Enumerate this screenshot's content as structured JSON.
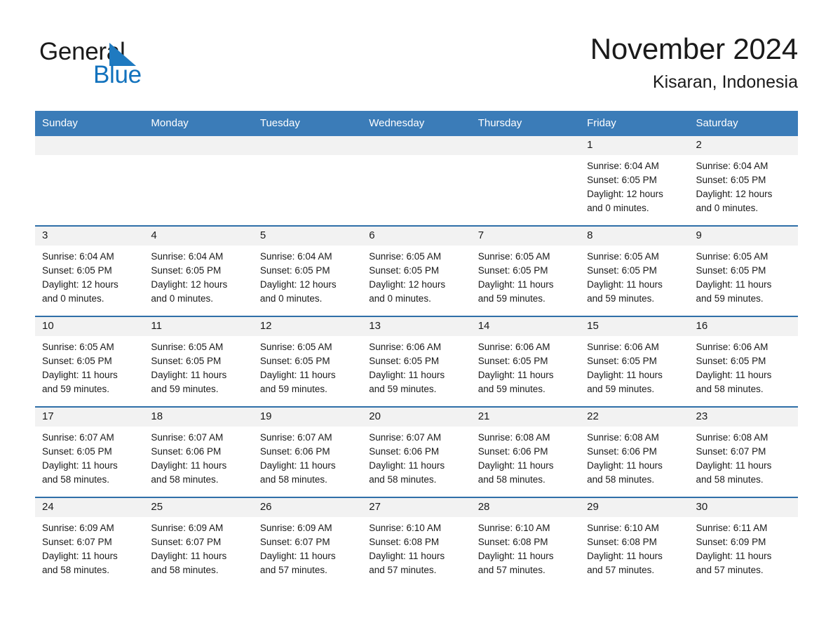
{
  "brand": {
    "word1": "General",
    "word2": "Blue",
    "triangle_color": "#1f7ac0",
    "blue_color": "#1272bd"
  },
  "header": {
    "title": "November 2024",
    "location": "Kisaran, Indonesia"
  },
  "theme": {
    "header_bar": "#3b7cb8",
    "row_divider": "#2f6fa8",
    "daynum_band": "#f2f2f2",
    "text": "#1a1a1a"
  },
  "weekday_headers": [
    "Sunday",
    "Monday",
    "Tuesday",
    "Wednesday",
    "Thursday",
    "Friday",
    "Saturday"
  ],
  "labels": {
    "sunrise_prefix": "Sunrise:",
    "sunset_prefix": "Sunset:",
    "daylight_prefix": "Daylight:"
  },
  "weeks": [
    [
      {
        "day": "",
        "empty": true
      },
      {
        "day": "",
        "empty": true
      },
      {
        "day": "",
        "empty": true
      },
      {
        "day": "",
        "empty": true
      },
      {
        "day": "",
        "empty": true
      },
      {
        "day": "1",
        "sunrise": "Sunrise: 6:04 AM",
        "sunset": "Sunset: 6:05 PM",
        "daylight1": "Daylight: 12 hours",
        "daylight2": "and 0 minutes."
      },
      {
        "day": "2",
        "sunrise": "Sunrise: 6:04 AM",
        "sunset": "Sunset: 6:05 PM",
        "daylight1": "Daylight: 12 hours",
        "daylight2": "and 0 minutes."
      }
    ],
    [
      {
        "day": "3",
        "sunrise": "Sunrise: 6:04 AM",
        "sunset": "Sunset: 6:05 PM",
        "daylight1": "Daylight: 12 hours",
        "daylight2": "and 0 minutes."
      },
      {
        "day": "4",
        "sunrise": "Sunrise: 6:04 AM",
        "sunset": "Sunset: 6:05 PM",
        "daylight1": "Daylight: 12 hours",
        "daylight2": "and 0 minutes."
      },
      {
        "day": "5",
        "sunrise": "Sunrise: 6:04 AM",
        "sunset": "Sunset: 6:05 PM",
        "daylight1": "Daylight: 12 hours",
        "daylight2": "and 0 minutes."
      },
      {
        "day": "6",
        "sunrise": "Sunrise: 6:05 AM",
        "sunset": "Sunset: 6:05 PM",
        "daylight1": "Daylight: 12 hours",
        "daylight2": "and 0 minutes."
      },
      {
        "day": "7",
        "sunrise": "Sunrise: 6:05 AM",
        "sunset": "Sunset: 6:05 PM",
        "daylight1": "Daylight: 11 hours",
        "daylight2": "and 59 minutes."
      },
      {
        "day": "8",
        "sunrise": "Sunrise: 6:05 AM",
        "sunset": "Sunset: 6:05 PM",
        "daylight1": "Daylight: 11 hours",
        "daylight2": "and 59 minutes."
      },
      {
        "day": "9",
        "sunrise": "Sunrise: 6:05 AM",
        "sunset": "Sunset: 6:05 PM",
        "daylight1": "Daylight: 11 hours",
        "daylight2": "and 59 minutes."
      }
    ],
    [
      {
        "day": "10",
        "sunrise": "Sunrise: 6:05 AM",
        "sunset": "Sunset: 6:05 PM",
        "daylight1": "Daylight: 11 hours",
        "daylight2": "and 59 minutes."
      },
      {
        "day": "11",
        "sunrise": "Sunrise: 6:05 AM",
        "sunset": "Sunset: 6:05 PM",
        "daylight1": "Daylight: 11 hours",
        "daylight2": "and 59 minutes."
      },
      {
        "day": "12",
        "sunrise": "Sunrise: 6:05 AM",
        "sunset": "Sunset: 6:05 PM",
        "daylight1": "Daylight: 11 hours",
        "daylight2": "and 59 minutes."
      },
      {
        "day": "13",
        "sunrise": "Sunrise: 6:06 AM",
        "sunset": "Sunset: 6:05 PM",
        "daylight1": "Daylight: 11 hours",
        "daylight2": "and 59 minutes."
      },
      {
        "day": "14",
        "sunrise": "Sunrise: 6:06 AM",
        "sunset": "Sunset: 6:05 PM",
        "daylight1": "Daylight: 11 hours",
        "daylight2": "and 59 minutes."
      },
      {
        "day": "15",
        "sunrise": "Sunrise: 6:06 AM",
        "sunset": "Sunset: 6:05 PM",
        "daylight1": "Daylight: 11 hours",
        "daylight2": "and 59 minutes."
      },
      {
        "day": "16",
        "sunrise": "Sunrise: 6:06 AM",
        "sunset": "Sunset: 6:05 PM",
        "daylight1": "Daylight: 11 hours",
        "daylight2": "and 58 minutes."
      }
    ],
    [
      {
        "day": "17",
        "sunrise": "Sunrise: 6:07 AM",
        "sunset": "Sunset: 6:05 PM",
        "daylight1": "Daylight: 11 hours",
        "daylight2": "and 58 minutes."
      },
      {
        "day": "18",
        "sunrise": "Sunrise: 6:07 AM",
        "sunset": "Sunset: 6:06 PM",
        "daylight1": "Daylight: 11 hours",
        "daylight2": "and 58 minutes."
      },
      {
        "day": "19",
        "sunrise": "Sunrise: 6:07 AM",
        "sunset": "Sunset: 6:06 PM",
        "daylight1": "Daylight: 11 hours",
        "daylight2": "and 58 minutes."
      },
      {
        "day": "20",
        "sunrise": "Sunrise: 6:07 AM",
        "sunset": "Sunset: 6:06 PM",
        "daylight1": "Daylight: 11 hours",
        "daylight2": "and 58 minutes."
      },
      {
        "day": "21",
        "sunrise": "Sunrise: 6:08 AM",
        "sunset": "Sunset: 6:06 PM",
        "daylight1": "Daylight: 11 hours",
        "daylight2": "and 58 minutes."
      },
      {
        "day": "22",
        "sunrise": "Sunrise: 6:08 AM",
        "sunset": "Sunset: 6:06 PM",
        "daylight1": "Daylight: 11 hours",
        "daylight2": "and 58 minutes."
      },
      {
        "day": "23",
        "sunrise": "Sunrise: 6:08 AM",
        "sunset": "Sunset: 6:07 PM",
        "daylight1": "Daylight: 11 hours",
        "daylight2": "and 58 minutes."
      }
    ],
    [
      {
        "day": "24",
        "sunrise": "Sunrise: 6:09 AM",
        "sunset": "Sunset: 6:07 PM",
        "daylight1": "Daylight: 11 hours",
        "daylight2": "and 58 minutes."
      },
      {
        "day": "25",
        "sunrise": "Sunrise: 6:09 AM",
        "sunset": "Sunset: 6:07 PM",
        "daylight1": "Daylight: 11 hours",
        "daylight2": "and 58 minutes."
      },
      {
        "day": "26",
        "sunrise": "Sunrise: 6:09 AM",
        "sunset": "Sunset: 6:07 PM",
        "daylight1": "Daylight: 11 hours",
        "daylight2": "and 57 minutes."
      },
      {
        "day": "27",
        "sunrise": "Sunrise: 6:10 AM",
        "sunset": "Sunset: 6:08 PM",
        "daylight1": "Daylight: 11 hours",
        "daylight2": "and 57 minutes."
      },
      {
        "day": "28",
        "sunrise": "Sunrise: 6:10 AM",
        "sunset": "Sunset: 6:08 PM",
        "daylight1": "Daylight: 11 hours",
        "daylight2": "and 57 minutes."
      },
      {
        "day": "29",
        "sunrise": "Sunrise: 6:10 AM",
        "sunset": "Sunset: 6:08 PM",
        "daylight1": "Daylight: 11 hours",
        "daylight2": "and 57 minutes."
      },
      {
        "day": "30",
        "sunrise": "Sunrise: 6:11 AM",
        "sunset": "Sunset: 6:09 PM",
        "daylight1": "Daylight: 11 hours",
        "daylight2": "and 57 minutes."
      }
    ]
  ]
}
